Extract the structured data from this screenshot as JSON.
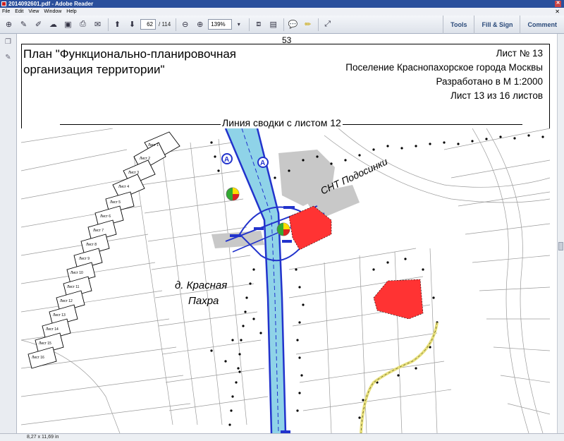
{
  "window": {
    "title": "2014092601.pdf - Adobe Reader"
  },
  "menu": [
    "File",
    "Edit",
    "View",
    "Window",
    "Help"
  ],
  "toolbar": {
    "page_current": "62",
    "page_total": "/ 114",
    "zoom": "139%",
    "tools_label": "Tools",
    "fill_sign_label": "Fill & Sign",
    "comment_label": "Comment"
  },
  "status": {
    "page_size": "8,27 x 11,69 in"
  },
  "doc": {
    "page_number": "53",
    "title_line1": "План \"Функционально-планировочная",
    "title_line2": "организация территории\"",
    "sheet_no": "Лист № 13",
    "settlement": "Поселение Краснопахорское города Москвы",
    "scale": "Разработано в М 1:2000",
    "sheet_of": "Лист 13 из 16 листов",
    "stitch_label": "Линия сводки с листом 12",
    "village_label_1": "д. Красная",
    "village_label_2": "Пахра",
    "snt_label": "СНТ Подосинки",
    "road_marker": "A",
    "sheet_index": [
      "Лист 1",
      "Лист 2",
      "Лист 3",
      "Лист 4",
      "Лист 5",
      "Лист 6",
      "Лист 7",
      "Лист 8",
      "Лист 9",
      "Лист 10",
      "Лист 11",
      "Лист 12",
      "Лист 13",
      "Лист 14",
      "Лист 15",
      "Лист 16"
    ]
  },
  "colors": {
    "titlebar": "#2a4f9c",
    "road_blue": "#2233cc",
    "zone_red": "#ff3333",
    "area_gray": "#c8c8c8",
    "path_yellow": "#e8e07a"
  }
}
